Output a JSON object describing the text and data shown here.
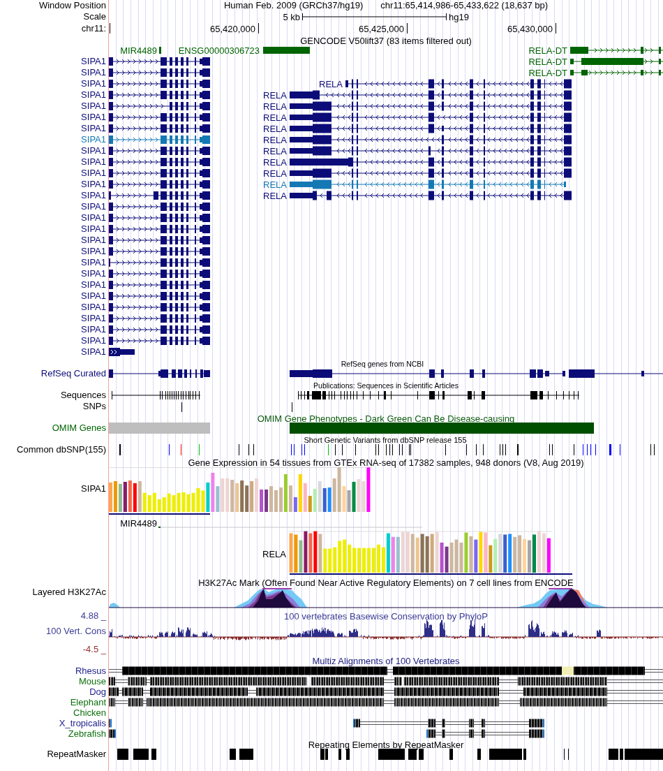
{
  "header": {
    "position_label": "Window Position",
    "assembly_title": "Human Feb. 2009 (GRCh37/hg19)",
    "position": "chr11:65,414,986-65,433,622 (18,637 bp)",
    "scale_label": "Scale",
    "scale_length": "5 kb",
    "scale_assembly": "hg19",
    "ruler_label": "chr11:",
    "ruler_ticks": [
      "65,420,000",
      "65,425,000",
      "65,430,000"
    ]
  },
  "gencode": {
    "title": "GENCODE V50lift37 (83 items filtered out)",
    "rows": [
      [
        {
          "name": "MIR4489",
          "color": "#006400"
        },
        {
          "name": "ENSG00000306723",
          "color": "#006400"
        },
        {
          "name": "RELA-DT",
          "color": "#006400"
        }
      ],
      [
        {
          "name": "SIPA1",
          "color": "#0c0c78"
        },
        {
          "name": "RELA-DT",
          "color": "#006400"
        }
      ],
      [
        {
          "name": "SIPA1",
          "color": "#0c0c78"
        },
        {
          "name": "RELA-DT",
          "color": "#006400"
        }
      ],
      [
        {
          "name": "SIPA1",
          "color": "#0c0c78"
        },
        {
          "name": "RELA",
          "color": "#0c0c78"
        }
      ],
      [
        {
          "name": "SIPA1",
          "color": "#0c0c78"
        },
        {
          "name": "RELA",
          "color": "#0c0c78"
        }
      ],
      [
        {
          "name": "SIPA1",
          "color": "#0c0c78"
        },
        {
          "name": "RELA",
          "color": "#0c0c78"
        }
      ],
      [
        {
          "name": "SIPA1",
          "color": "#0c0c78"
        },
        {
          "name": "RELA",
          "color": "#0c0c78"
        }
      ],
      [
        {
          "name": "SIPA1",
          "color": "#0c0c78"
        },
        {
          "name": "RELA",
          "color": "#0c0c78"
        }
      ],
      [
        {
          "name": "SIPA1",
          "color": "#1478b4"
        },
        {
          "name": "RELA",
          "color": "#0c0c78"
        }
      ],
      [
        {
          "name": "SIPA1",
          "color": "#0c0c78"
        },
        {
          "name": "RELA",
          "color": "#0c0c78"
        }
      ],
      [
        {
          "name": "SIPA1",
          "color": "#0c0c78"
        },
        {
          "name": "RELA",
          "color": "#0c0c78"
        }
      ],
      [
        {
          "name": "SIPA1",
          "color": "#0c0c78"
        },
        {
          "name": "RELA",
          "color": "#0c0c78"
        }
      ],
      [
        {
          "name": "SIPA1",
          "color": "#0c0c78"
        },
        {
          "name": "RELA",
          "color": "#1478b4"
        }
      ],
      [
        {
          "name": "SIPA1",
          "color": "#0c0c78"
        },
        {
          "name": "RELA",
          "color": "#0c0c78"
        }
      ],
      [
        {
          "name": "SIPA1",
          "color": "#0c0c78"
        }
      ],
      [
        {
          "name": "SIPA1",
          "color": "#0c0c78"
        }
      ],
      [
        {
          "name": "SIPA1",
          "color": "#0c0c78"
        }
      ],
      [
        {
          "name": "SIPA1",
          "color": "#0c0c78"
        }
      ],
      [
        {
          "name": "SIPA1",
          "color": "#0c0c78"
        }
      ],
      [
        {
          "name": "SIPA1",
          "color": "#0c0c78"
        }
      ],
      [
        {
          "name": "SIPA1",
          "color": "#0c0c78"
        }
      ],
      [
        {
          "name": "SIPA1",
          "color": "#0c0c78"
        }
      ],
      [
        {
          "name": "SIPA1",
          "color": "#0c0c78"
        }
      ],
      [
        {
          "name": "SIPA1",
          "color": "#0c0c78"
        }
      ],
      [
        {
          "name": "SIPA1",
          "color": "#0c0c78"
        }
      ],
      [
        {
          "name": "SIPA1",
          "color": "#0c0c78"
        }
      ],
      [
        {
          "name": "SIPA1",
          "color": "#0c0c78"
        }
      ],
      [
        {
          "name": "SIPA1",
          "color": "#0c0c78"
        }
      ]
    ]
  },
  "refseq": {
    "label": "RefSeq Curated",
    "title": "RefSeq genes from NCBI"
  },
  "publications": {
    "title": "Publications: Sequences in Scientific Articles",
    "sequences_label": "Sequences",
    "snps_label": "SNPs"
  },
  "omim": {
    "label": "OMIM Genes",
    "title": "OMIM Gene Phenotypes - Dark Green Can Be Disease-causing"
  },
  "dbsnp": {
    "label": "Common dbSNP(155)",
    "title": "Short Genetic Variants from dbSNP release 155"
  },
  "gtex": {
    "title": "Gene Expression in 54 tissues from GTEx RNA-seq of 17382 samples, 948 donors (V8, Aug 2019)",
    "genes": [
      {
        "name": "SIPA1"
      },
      {
        "name": "MIR4489"
      },
      {
        "name": "RELA"
      }
    ]
  },
  "h3k27ac": {
    "label": "Layered H3K27Ac",
    "title": "H3K27Ac Mark (Often Found Near Active Regulatory Elements) on 7 cell lines from ENCODE"
  },
  "conservation": {
    "max_label": "4.88 _",
    "label": "100 Vert. Cons",
    "min_label": "-4.5 _",
    "title": "100 vertebrates Basewise Conservation by PhyloP"
  },
  "multiz": {
    "title": "Multiz Alignments of 100 Vertebrates",
    "species": [
      {
        "name": "Rhesus",
        "color": "#1c1c8c"
      },
      {
        "name": "Mouse",
        "color": "#0d700d"
      },
      {
        "name": "Dog",
        "color": "#1c1c8c"
      },
      {
        "name": "Elephant",
        "color": "#0d700d"
      },
      {
        "name": "Chicken",
        "color": "#0d700d"
      },
      {
        "name": "X_tropicalis",
        "color": "#1c1c8c"
      },
      {
        "name": "Zebrafish",
        "color": "#0d700d"
      }
    ]
  },
  "repeatmasker": {
    "label": "RepeatMasker",
    "title": "Repeating Elements by RepeatMasker"
  }
}
